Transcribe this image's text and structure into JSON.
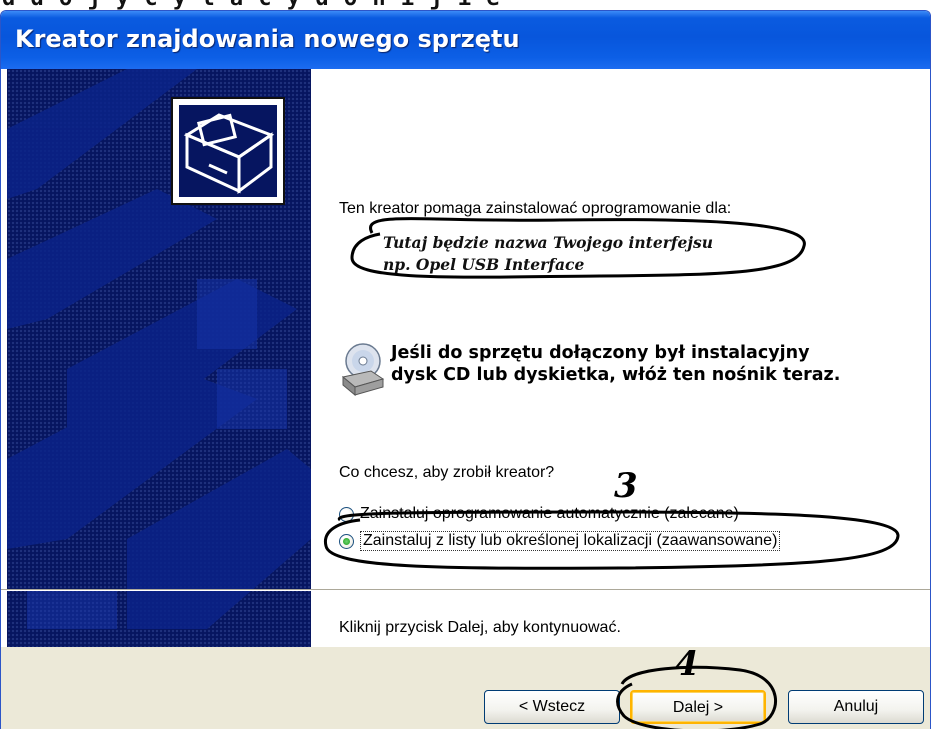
{
  "top_strip_text": "d d  o j y c   y l a c y   d o n i j   i   e",
  "window": {
    "title": "Kreator znajdowania nowego sprzętu"
  },
  "wizard": {
    "intro": "Ten kreator pomaga zainstalować oprogramowanie dla:",
    "device_line_1": "Tutaj będzie nazwa Twojego interfejsu",
    "device_line_2": "np. Opel USB Interface",
    "cd_hint_line_1": "Jeśli do sprzętu dołączony był instalacyjny",
    "cd_hint_line_2": "dysk CD lub dyskietka, włóż ten nośnik teraz.",
    "question": "Co chcesz, aby zrobił kreator?",
    "option_auto_label": "Zainstaluj oprogramowanie automatycznie (zalecane)",
    "option_list_label": "Zainstaluj z listy lub określonej lokalizacji (zaawansowane)",
    "selected_option": "option_list",
    "continue_hint": "Kliknij przycisk Dalej, aby kontynuować."
  },
  "buttons": {
    "back": "< Wstecz",
    "next": "Dalej >",
    "cancel": "Anuluj"
  },
  "annotations": {
    "step3": "3",
    "step4": "4"
  },
  "icons": {
    "hardware": "hardware-wizard-icon",
    "cd": "cd-drive-icon"
  },
  "colors": {
    "titlebar": "#0856dc",
    "sidebar": "#061560",
    "dialog_bg": "#ece9d8",
    "default_button_border": "#ffb400",
    "radio_check": "#21a121"
  }
}
